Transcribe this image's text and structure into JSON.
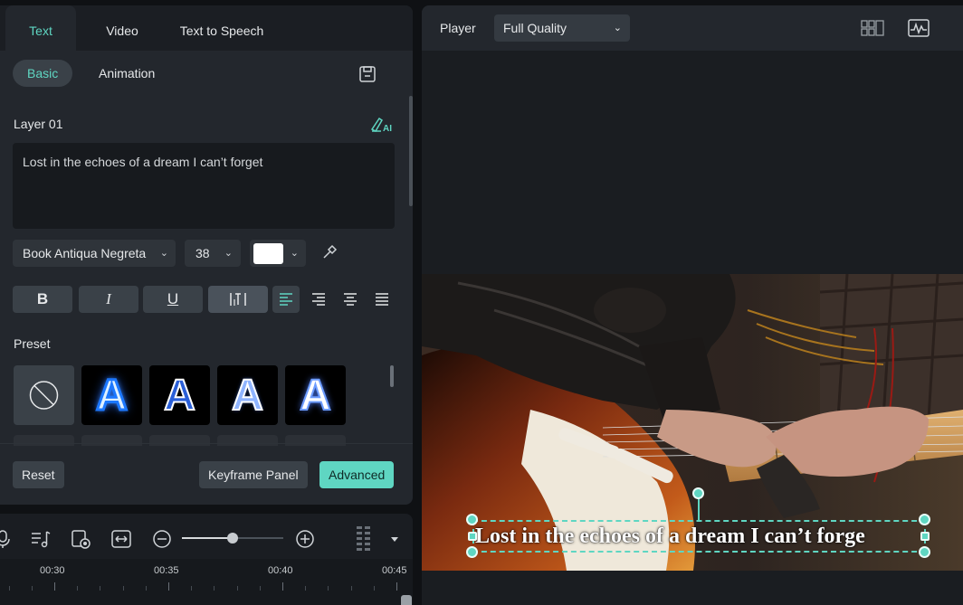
{
  "tabs": [
    "Text",
    "Video",
    "Text to Speech"
  ],
  "subtabs": [
    "Basic",
    "Animation"
  ],
  "layer_label": "Layer 01",
  "text_content": "Lost in the echoes of a dream I can’t forget",
  "font": {
    "family": "Book Antiqua Negreta",
    "size": "38",
    "color": "#ffffff"
  },
  "format_buttons": {
    "bold": "B",
    "italic": "I",
    "underline": "U"
  },
  "preset_label": "Preset",
  "presets": [
    "none",
    "blue-glow",
    "white-outline",
    "blue-outline",
    "blue-soft-glow"
  ],
  "buttons": {
    "reset": "Reset",
    "keyframe": "Keyframe Panel",
    "advanced": "Advanced"
  },
  "timeline": {
    "labels": [
      "00:30",
      "00:35",
      "00:40",
      "00:45"
    ],
    "zoom_level": 0.5
  },
  "player": {
    "label": "Player",
    "quality": "Full Quality",
    "caption": "Lost in the echoes of a dream I can’t forge"
  },
  "colors": {
    "accent": "#5fd6c2",
    "panel": "#23272d",
    "background": "#0f1114"
  },
  "icons": [
    "save-preset-icon",
    "ai-edit-icon",
    "eyedropper-icon",
    "align-left-icon",
    "align-right-icon",
    "align-center-icon",
    "align-justify-icon",
    "no-preset-icon",
    "microphone-icon",
    "music-note-icon",
    "clip-record-icon",
    "fit-icon",
    "zoom-out-icon",
    "zoom-in-icon",
    "grip-icon",
    "grid-view-icon",
    "waveform-scope-icon"
  ]
}
